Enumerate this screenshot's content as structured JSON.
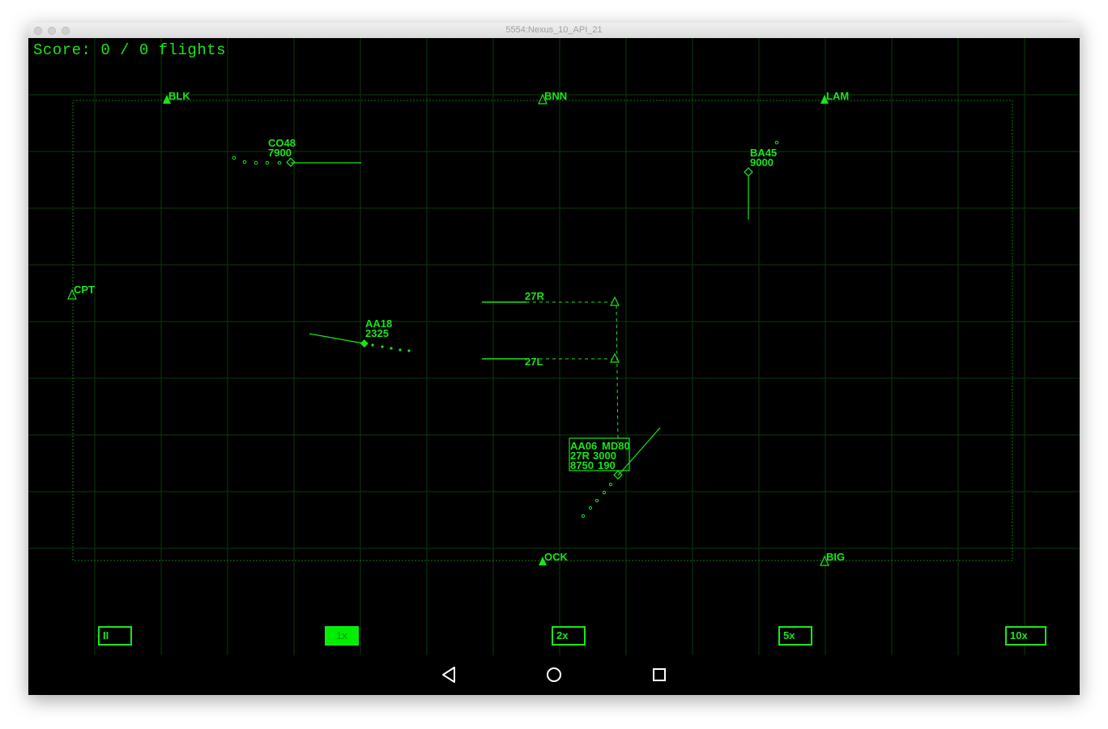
{
  "window": {
    "title": "5554:Nexus_10_API_21"
  },
  "hud": {
    "score_text": "Score: 0 / 0 flights"
  },
  "colors": {
    "radar_green": "#19e619",
    "grid": "#0b3a0b",
    "background": "#000000"
  },
  "beacons": [
    {
      "name": "BLK",
      "filled": true
    },
    {
      "name": "BNN",
      "filled": false
    },
    {
      "name": "LAM",
      "filled": true
    },
    {
      "name": "CPT",
      "filled": false
    },
    {
      "name": "OCK",
      "filled": true
    },
    {
      "name": "BIG",
      "filled": false
    }
  ],
  "runways": [
    {
      "name": "27R"
    },
    {
      "name": "27L"
    }
  ],
  "aircraft": [
    {
      "callsign": "CO48",
      "altitude": "7900"
    },
    {
      "callsign": "BA45",
      "altitude": "9000"
    },
    {
      "callsign": "AA18",
      "altitude": "2325"
    },
    {
      "callsign": "AA06",
      "type": "MD80",
      "runway": "27R",
      "target_altitude": "3000",
      "altitude": "8750",
      "speed": "190",
      "selected": true
    }
  ],
  "speed_controls": [
    {
      "label": "II",
      "name": "pause-button",
      "active": false
    },
    {
      "label": "1x",
      "name": "speed-1x-button",
      "active": true
    },
    {
      "label": "2x",
      "name": "speed-2x-button",
      "active": false
    },
    {
      "label": "5x",
      "name": "speed-5x-button",
      "active": false
    },
    {
      "label": "10x",
      "name": "speed-10x-button",
      "active": false
    }
  ],
  "navigation": {
    "back_icon": "back-triangle-icon",
    "home_icon": "home-circle-icon",
    "recents_icon": "recents-square-icon"
  }
}
